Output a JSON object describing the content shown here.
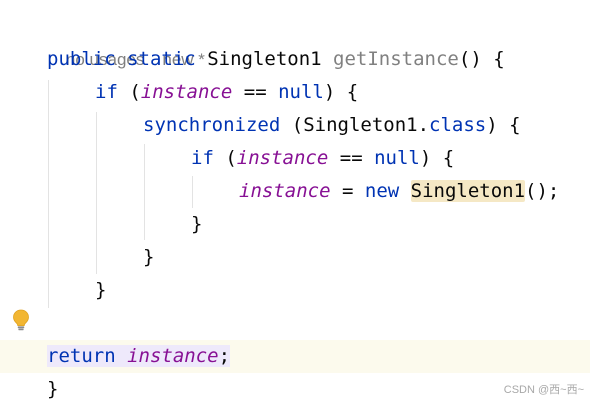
{
  "editor": {
    "inlay_hints": {
      "usages": "no usages",
      "vcs": "new *"
    },
    "code": {
      "public": "public",
      "static": "static",
      "return_type": "Singleton1",
      "method_name": "getInstance",
      "method_parens": "()",
      "open_brace": "{",
      "close_brace": "}",
      "if_kw": "if",
      "open_paren": "(",
      "instance_field": "instance",
      "eq_op": "==",
      "null_kw": "null",
      "close_paren_brace": ") {",
      "synchronized_kw": "synchronized",
      "class_ref": "Singleton1",
      "dot": ".",
      "class_kw": "class",
      "assign_op": "=",
      "new_kw": "new",
      "ctor_name": "Singleton1",
      "ctor_call_tail": "();",
      "return_kw": "return",
      "semicolon": ";"
    },
    "gutter": {
      "intention_icon": "lightbulb-icon"
    },
    "colors": {
      "keyword": "#0033b3",
      "field": "#871094",
      "method_declaration": "#808080",
      "usage_highlight": "#f5e8c5",
      "caret_line": "#fcfaed"
    }
  },
  "watermark": "CSDN @西~西~"
}
